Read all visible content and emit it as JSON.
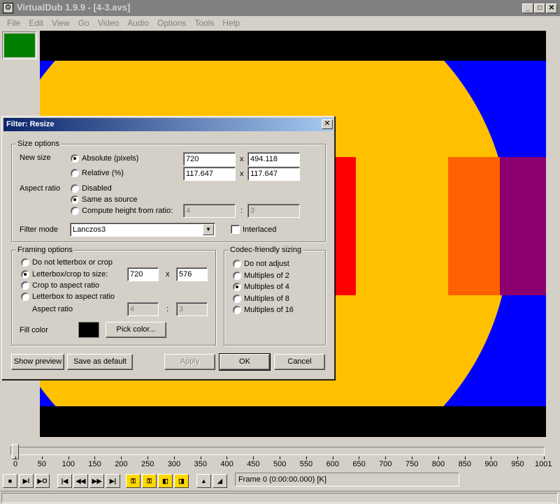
{
  "window": {
    "app_icon_glyph": "⚙",
    "title": "VirtualDub 1.9.9 - [4-3.avs]",
    "controls": {
      "minimize": "_",
      "maximize": "□",
      "close": "✕"
    }
  },
  "menu": [
    "File",
    "Edit",
    "View",
    "Go",
    "Video",
    "Audio",
    "Options",
    "Tools",
    "Help"
  ],
  "colors": {
    "frame_thumb": "#008000",
    "video_background": "#0000ff",
    "circle": "#ffc000",
    "red_bar": "#ff0000",
    "orange_bar": "#ff6000",
    "purple_bar": "#8c0070",
    "letterbox": "#000000",
    "dialog_titlebar": "#0a246a"
  },
  "timeline": {
    "ticks": [
      "0",
      "50",
      "100",
      "150",
      "200",
      "250",
      "300",
      "350",
      "400",
      "450",
      "500",
      "550",
      "600",
      "650",
      "700",
      "750",
      "800",
      "850",
      "900",
      "950",
      "1001"
    ],
    "position": 0
  },
  "toolbar": {
    "buttons": [
      {
        "name": "stop-icon",
        "glyph": "■"
      },
      {
        "name": "play-input-icon",
        "glyph": "▶I"
      },
      {
        "name": "play-output-icon",
        "glyph": "▶O"
      },
      {
        "name": "go-start-icon",
        "glyph": "|◀"
      },
      {
        "name": "step-back-icon",
        "glyph": "◀◀"
      },
      {
        "name": "step-forward-icon",
        "glyph": "▶▶"
      },
      {
        "name": "go-end-icon",
        "glyph": "▶|"
      },
      {
        "name": "prev-key-icon",
        "glyph": "⚿"
      },
      {
        "name": "next-key-icon",
        "glyph": "⚿"
      },
      {
        "name": "prev-scene-icon",
        "glyph": "◧"
      },
      {
        "name": "next-scene-icon",
        "glyph": "◨"
      },
      {
        "name": "mark-in-icon",
        "glyph": "▲"
      },
      {
        "name": "mark-out-icon",
        "glyph": "◢"
      }
    ],
    "frame_status": "Frame 0 (0:00:00.000) [K]"
  },
  "dialog": {
    "title": "Filter: Resize",
    "close_glyph": "✕",
    "size_options": {
      "legend": "Size options",
      "new_size_label": "New size",
      "absolute_label": "Absolute (pixels)",
      "absolute_width": "720",
      "absolute_height": "494.118",
      "relative_label": "Relative (%)",
      "relative_width": "117.647",
      "relative_height": "117.647",
      "by": "x",
      "aspect_ratio_label": "Aspect ratio",
      "disabled_label": "Disabled",
      "same_as_source_label": "Same as source",
      "compute_height_label": "Compute height from ratio:",
      "ratio_num": "4",
      "ratio_den": "3",
      "colon": ":",
      "filter_mode_label": "Filter mode",
      "filter_mode_value": "Lanczos3",
      "interlaced_label": "Interlaced"
    },
    "framing_options": {
      "legend": "Framing options",
      "no_letterbox_label": "Do not letterbox or crop",
      "letterbox_size_label": "Letterbox/crop to size:",
      "width": "720",
      "height": "576",
      "by": "x",
      "crop_aspect_label": "Crop to aspect ratio",
      "letterbox_aspect_label": "Letterbox to aspect ratio",
      "aspect_ratio_label": "Aspect ratio",
      "aspect_num": "4",
      "aspect_den": "3",
      "colon": ":",
      "fill_color_label": "Fill color",
      "fill_color": "#000000",
      "pick_color_label": "Pick color..."
    },
    "codec_sizing": {
      "legend": "Codec-friendly sizing",
      "options": [
        "Do not adjust",
        "Multiples of 2",
        "Multiples of 4",
        "Multiples of 8",
        "Multiples of 16"
      ],
      "selected": "Multiples of 4"
    },
    "buttons": {
      "show_preview": "Show preview",
      "save_default": "Save as default",
      "apply": "Apply",
      "ok": "OK",
      "cancel": "Cancel"
    }
  }
}
